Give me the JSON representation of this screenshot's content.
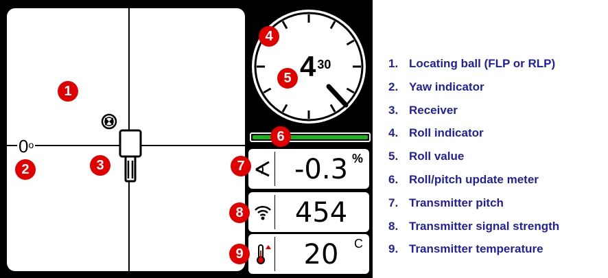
{
  "locate_view": {
    "yaw_value": "0",
    "yaw_unit": "o"
  },
  "roll": {
    "value": "4",
    "superscript": "30",
    "update_meter_fraction": 1.0
  },
  "pitch": {
    "value": "-0.3",
    "unit": "%"
  },
  "signal": {
    "value": "454"
  },
  "temperature": {
    "value": "20",
    "unit": "C"
  },
  "callouts": [
    "1",
    "2",
    "3",
    "4",
    "5",
    "6",
    "7",
    "8",
    "9"
  ],
  "legend": [
    {
      "num": "1.",
      "label": "Locating ball (FLP or RLP)"
    },
    {
      "num": "2.",
      "label": "Yaw indicator"
    },
    {
      "num": "3.",
      "label": "Receiver"
    },
    {
      "num": "4.",
      "label": "Roll indicator"
    },
    {
      "num": "5.",
      "label": "Roll value"
    },
    {
      "num": "6.",
      "label": "Roll/pitch update meter"
    },
    {
      "num": "7.",
      "label": "Transmitter pitch"
    },
    {
      "num": "8.",
      "label": "Transmitter signal strength"
    },
    {
      "num": "9.",
      "label": "Transmitter temperature"
    }
  ],
  "colors": {
    "callout": "#e00000",
    "legend_text": "#1f1fa0",
    "meter_fill": "#19b219",
    "screen_bg": "#000000"
  },
  "icons": {
    "ball": "locating-ball-icon",
    "receiver": "receiver-icon",
    "pitch": "pitch-icon",
    "signal": "signal-strength-icon",
    "temperature": "thermometer-icon"
  }
}
